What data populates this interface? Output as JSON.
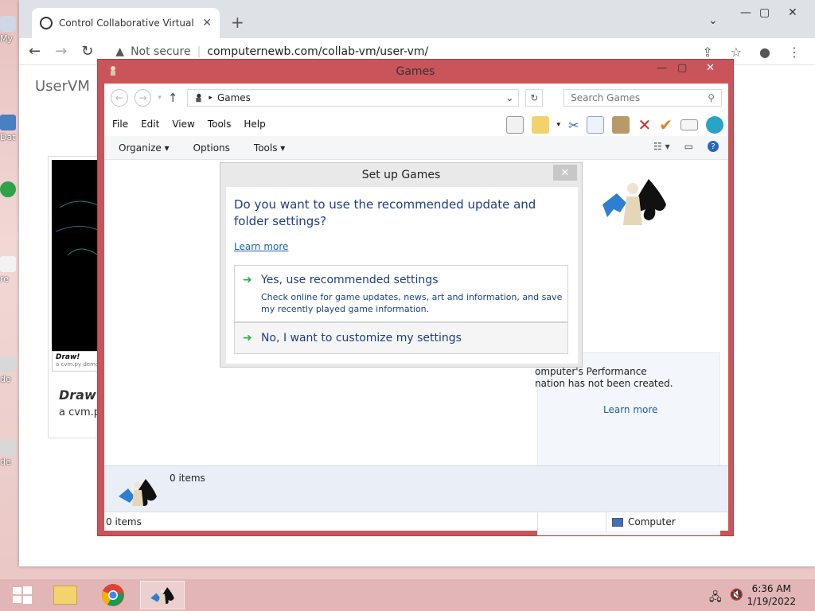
{
  "desktop": {
    "fragments": [
      "My",
      "Dat",
      "re",
      "de",
      "de"
    ]
  },
  "browser": {
    "tab_title": "Control Collaborative Virtual Ma",
    "omnibox": {
      "security": "Not secure",
      "url": "computernewb.com/collab-vm/user-vm/"
    },
    "page_title": "UserVM",
    "card": {
      "caption": "Draw!",
      "caption_sub": "a cvm.py demo",
      "heading": "Draw!",
      "subheading": "a cvm.p"
    }
  },
  "explorer": {
    "title": "Games",
    "address": "Games",
    "search_placeholder": "Search Games",
    "menu": [
      "File",
      "Edit",
      "View",
      "Tools",
      "Help"
    ],
    "commands": [
      "Organize",
      "Options",
      "Tools"
    ],
    "perf_text_line1": "omputer's Performance",
    "perf_text_line2": "nation has not been created.",
    "perf_link": "Learn more",
    "details_count": "0 items",
    "status_count": "0 items",
    "status_location": "Computer"
  },
  "dialog": {
    "title": "Set up Games",
    "question": "Do you want to use the recommended update and folder settings?",
    "learn_more": "Learn more",
    "option_yes": {
      "label": "Yes, use recommended settings",
      "description": "Check online for game updates, news, art and information, and save my recently played game information."
    },
    "option_no": {
      "label": "No, I want to customize my settings"
    }
  },
  "taskbar": {
    "time": "6:36 AM",
    "date": "1/19/2022"
  }
}
